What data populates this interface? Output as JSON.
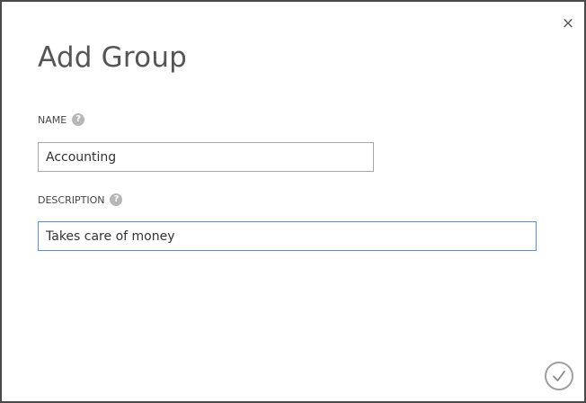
{
  "dialog": {
    "title": "Add Group",
    "close_glyph": "×"
  },
  "form": {
    "name": {
      "label": "NAME",
      "help_glyph": "?",
      "value": "Accounting"
    },
    "description": {
      "label": "DESCRIPTION",
      "help_glyph": "?",
      "value": "Takes care of money"
    }
  },
  "icons": {
    "close": "close-icon",
    "help": "question-icon",
    "confirm": "checkmark-icon"
  },
  "colors": {
    "focus_border": "#5b8fd6",
    "title_text": "#555555",
    "help_icon": "#b7b7b7"
  }
}
